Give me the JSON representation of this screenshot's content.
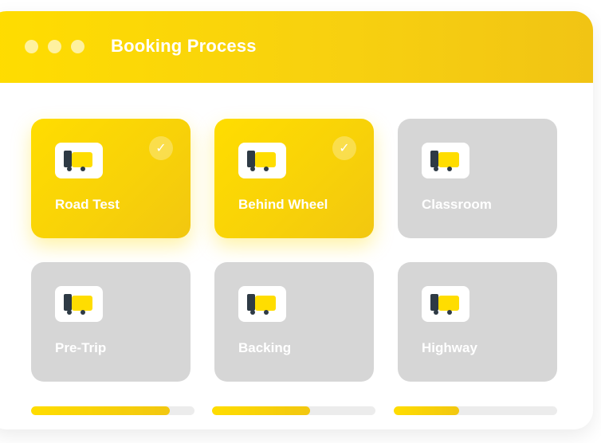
{
  "window": {
    "title": "Booking Process"
  },
  "colors": {
    "accent": "#FFDD00",
    "inactive": "#D6D6D6",
    "truck_cab": "#2E3A45"
  },
  "cards": [
    {
      "label": "Road Test",
      "icon": "truck-icon",
      "selected": true
    },
    {
      "label": "Behind Wheel",
      "icon": "truck-icon",
      "selected": true
    },
    {
      "label": "Classroom",
      "icon": "truck-icon",
      "selected": false
    },
    {
      "label": "Pre-Trip",
      "icon": "truck-icon",
      "selected": false
    },
    {
      "label": "Backing",
      "icon": "truck-icon",
      "selected": false
    },
    {
      "label": "Highway",
      "icon": "truck-icon",
      "selected": false
    }
  ],
  "check_glyph": "✓",
  "progress": [
    0.85,
    0.6,
    0.4
  ]
}
